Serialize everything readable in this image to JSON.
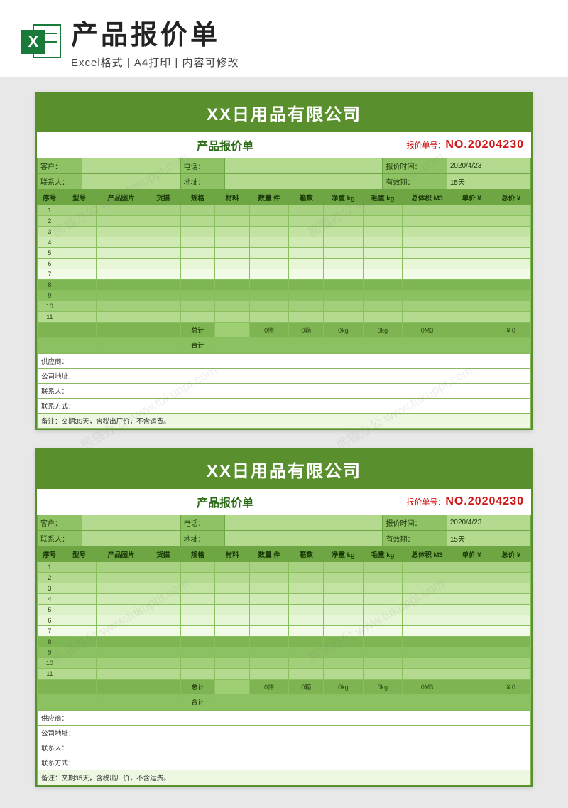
{
  "header": {
    "title": "产品报价单",
    "subtitle": "Excel格式 | A4打印 | 内容可修改",
    "icon_letter": "X"
  },
  "sheet": {
    "company": "XX日用品有限公司",
    "subtitle": "产品报价单",
    "quote_no_label": "报价单号：",
    "quote_no": "NO.20204230",
    "info": {
      "customer_label": "客户：",
      "customer": "",
      "phone_label": "电话：",
      "phone": "",
      "quote_time_label": "报价时间：",
      "quote_time": "2020/4/23",
      "contact_label": "联系人：",
      "contact": "",
      "address_label": "地址：",
      "address": "",
      "valid_label": "有效期：",
      "valid": "15天"
    },
    "columns": [
      "序号",
      "型号",
      "产品图片",
      "货描",
      "规格",
      "材料",
      "数量 件",
      "箱数",
      "净重 kg",
      "毛重 kg",
      "总体积 M3",
      "单价 ¥",
      "总价 ¥"
    ],
    "row_indices": [
      "1",
      "2",
      "3",
      "4",
      "5",
      "6",
      "7",
      "8",
      "9",
      "10",
      "11"
    ],
    "totals": {
      "label": "总计",
      "qty": "0件",
      "boxes": "0箱",
      "net": "0kg",
      "gross": "0kg",
      "vol": "0M3",
      "unit": "",
      "sum": "¥ 0"
    },
    "heji_label": "合计",
    "footer": {
      "supplier_label": "供应商：",
      "addr_label": "公司地址：",
      "contact_label": "联系人：",
      "tel_label": "联系方式：",
      "note_label": "备注：",
      "note": "交期35天，含税出厂价，不含运费。"
    }
  },
  "watermark": "熊猫办公 www.tukuppt.com"
}
